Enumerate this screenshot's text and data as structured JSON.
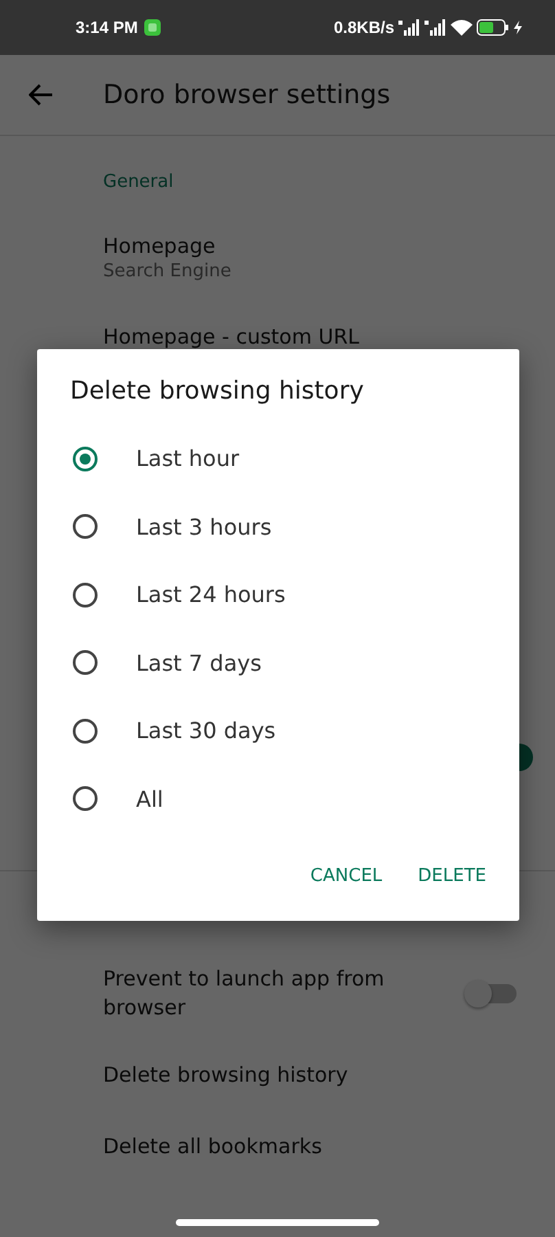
{
  "status_bar": {
    "time": "3:14 PM",
    "net_speed": "0.8KB/s"
  },
  "app_bar": {
    "title": "Doro browser settings"
  },
  "settings": [
    {
      "kind": "header",
      "title": "General"
    },
    {
      "kind": "item",
      "title": "Homepage",
      "subtitle": "Search Engine"
    },
    {
      "kind": "item",
      "title": "Homepage - custom URL"
    },
    {
      "kind": "switch",
      "on": true
    },
    {
      "kind": "switch",
      "title": "Prevent to launch app from browser",
      "on": false,
      "divider_above": true
    },
    {
      "kind": "item",
      "title": "Delete browsing history"
    },
    {
      "kind": "item",
      "title": "Delete all bookmarks"
    }
  ],
  "dialog": {
    "title": "Delete browsing history",
    "options": [
      {
        "label": "Last hour",
        "selected": true
      },
      {
        "label": "Last 3 hours",
        "selected": false
      },
      {
        "label": "Last 24 hours",
        "selected": false
      },
      {
        "label": "Last 7 days",
        "selected": false
      },
      {
        "label": "Last 30 days",
        "selected": false
      },
      {
        "label": "All",
        "selected": false
      }
    ],
    "buttons": [
      "CANCEL",
      "DELETE"
    ]
  }
}
